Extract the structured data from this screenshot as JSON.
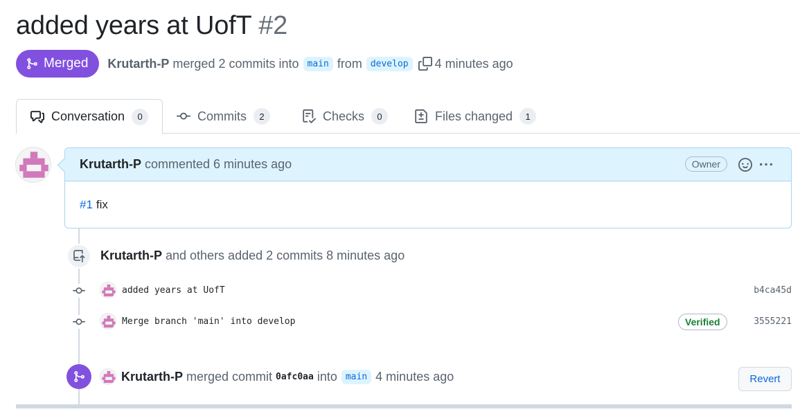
{
  "pr": {
    "title": "added years at UofT",
    "number": "#2",
    "status": "Merged",
    "author": "Krutarth-P",
    "merge_text": "merged 2 commits into",
    "base_branch": "main",
    "from_text": "from",
    "head_branch": "develop",
    "time": "4 minutes ago"
  },
  "tabs": [
    {
      "label": "Conversation",
      "count": "0",
      "icon": "comment-discussion-icon"
    },
    {
      "label": "Commits",
      "count": "2",
      "icon": "git-commit-icon"
    },
    {
      "label": "Checks",
      "count": "0",
      "icon": "checklist-icon"
    },
    {
      "label": "Files changed",
      "count": "1",
      "icon": "file-diff-icon"
    }
  ],
  "comment": {
    "author": "Krutarth-P",
    "action": "commented 6 minutes ago",
    "badge": "Owner",
    "body_ref": "#1",
    "body_text": "fix"
  },
  "commits_event": {
    "author": "Krutarth-P",
    "text": "and others added 2 commits 8 minutes ago",
    "commits": [
      {
        "message": "added years at UofT",
        "sha": "b4ca45d",
        "verified": ""
      },
      {
        "message": "Merge branch 'main' into develop",
        "sha": "3555221",
        "verified": "Verified"
      }
    ]
  },
  "merge_event": {
    "author": "Krutarth-P",
    "text": "merged commit",
    "sha": "0afc0aa",
    "into": "into",
    "branch": "main",
    "time": "4 minutes ago",
    "revert_label": "Revert"
  },
  "colors": {
    "merged_purple": "#8250df",
    "link_blue": "#0969da",
    "verified_green": "#1a7f37",
    "comment_header_bg": "#ddf4ff"
  }
}
